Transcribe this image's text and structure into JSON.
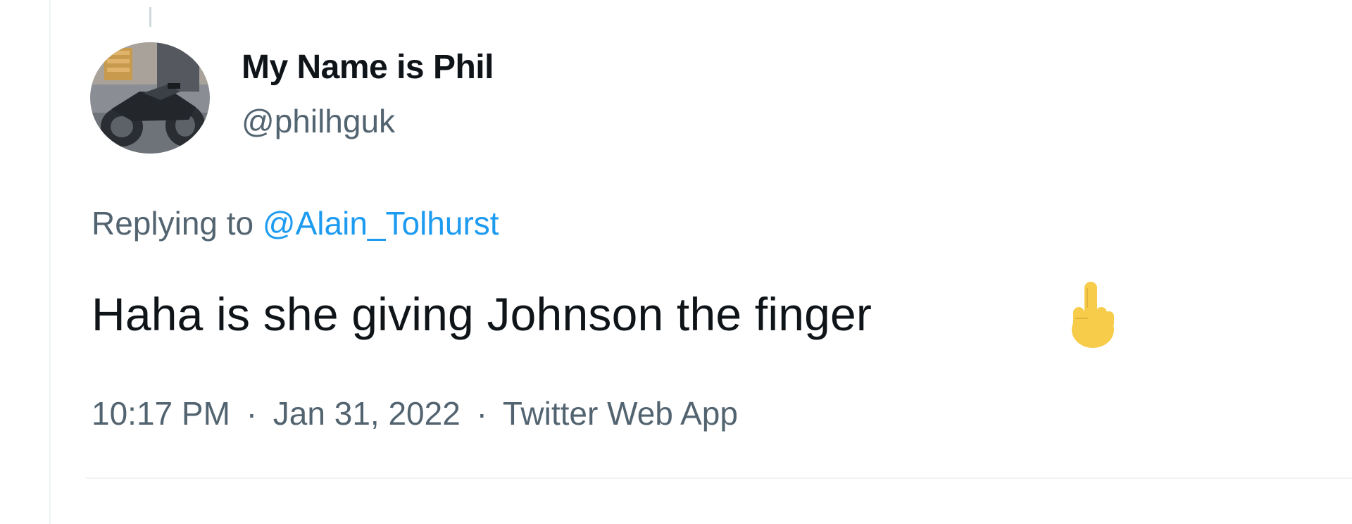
{
  "tweet": {
    "display_name": "My Name is Phil",
    "handle": "@philhguk",
    "replying_prefix": "Replying to",
    "replying_to": "@Alain_Tolhurst",
    "text": "Haha is she giving Johnson the finger",
    "emoji": "middle-finger-icon",
    "time": "10:17 PM",
    "separator": "·",
    "date": "Jan 31, 2022",
    "source": "Twitter Web App"
  },
  "colors": {
    "text_primary": "#0f1419",
    "text_secondary": "#536471",
    "link": "#1d9bf0",
    "emoji": "#f7cc4a",
    "divider": "#eff3f4"
  }
}
